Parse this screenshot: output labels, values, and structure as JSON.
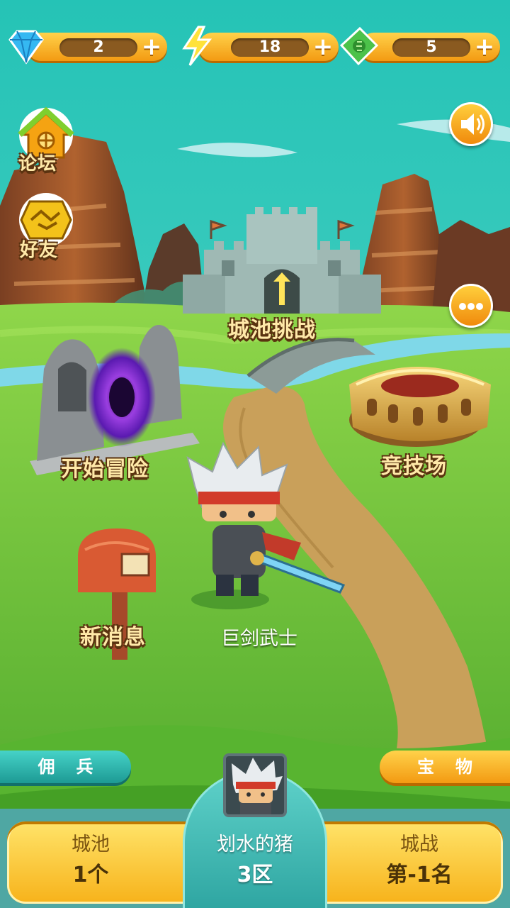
{
  "resources": [
    {
      "icon": "diamond-icon",
      "value": "2"
    },
    {
      "icon": "lightning-icon",
      "value": "18"
    },
    {
      "icon": "cash-icon",
      "value": "5"
    }
  ],
  "left_menu": {
    "forum_label": "论坛",
    "friends_label": "好友"
  },
  "places": {
    "castle": "城池挑战",
    "adventure": "开始冒险",
    "arena": "竞技场",
    "mailbox": "新消息"
  },
  "hero": {
    "name": "巨剑武士"
  },
  "tabs": {
    "mercenary": "佣兵",
    "treasure": "宝物"
  },
  "bottom": {
    "city_title": "城池",
    "city_value": "1个",
    "player_name": "划水的猪",
    "server": "3区",
    "war_title": "城战",
    "war_rank": "第-1名"
  },
  "colors": {
    "accent_orange": "#f5a312",
    "grass": "#6cc23a",
    "sky": "#2ec6b8",
    "panel_teal": "#3fb7b4"
  }
}
